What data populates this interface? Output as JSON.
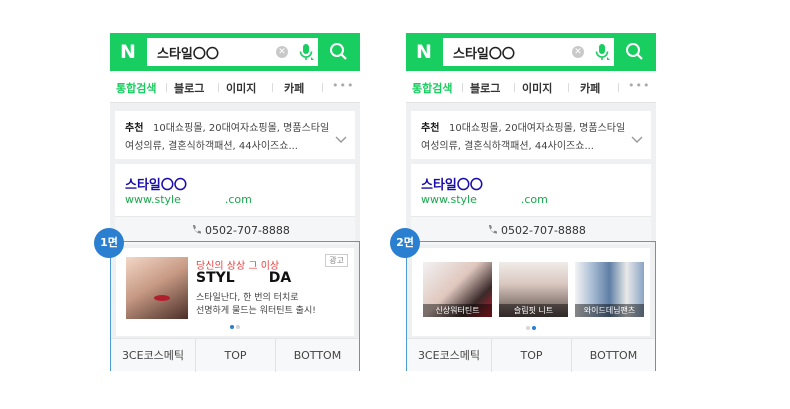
{
  "search": {
    "logo": "N",
    "query": "스타일〇〇",
    "clear": "✕"
  },
  "tabs": [
    "통합검색",
    "블로그",
    "이미지",
    "카페"
  ],
  "more": "•••",
  "recommend": {
    "label": "추천",
    "line1": "10대쇼핑몰, 20대여자쇼핑몰, 명품스타일",
    "line2": "여성의류, 결혼식하객패션, 44사이즈쇼..."
  },
  "site": {
    "title": "스타일〇〇",
    "url_prefix": "www.style",
    "url_suffix": ".com",
    "phone": "0502-707-8888"
  },
  "ad1": {
    "badge": "1면",
    "label": "광고",
    "catchphrase": "당신의 상상 그 이상",
    "brand_left": "STYL",
    "brand_right": "DA",
    "desc1": "스타일난다, 한 번의 터치로",
    "desc2": "선명하게 물드는 워터틴트 출시!",
    "dot_total": 2,
    "dot_active": 1,
    "tabs": [
      "3CE코스메틱",
      "TOP",
      "BOTTOM"
    ]
  },
  "ad2": {
    "badge": "2면",
    "thumbs": [
      "신상워터틴트",
      "슬림핏 니트",
      "와이드데님팬츠"
    ],
    "dot_total": 2,
    "dot_active": 2,
    "tabs": [
      "3CE코스메틱",
      "TOP",
      "BOTTOM"
    ]
  },
  "colors": {
    "brand": "#19ce60",
    "ad_frame": "#4f9bd6",
    "badge": "#2b7fd0",
    "title_link": "#1a0dab",
    "url": "#19a84d",
    "catch": "#e5423f"
  }
}
